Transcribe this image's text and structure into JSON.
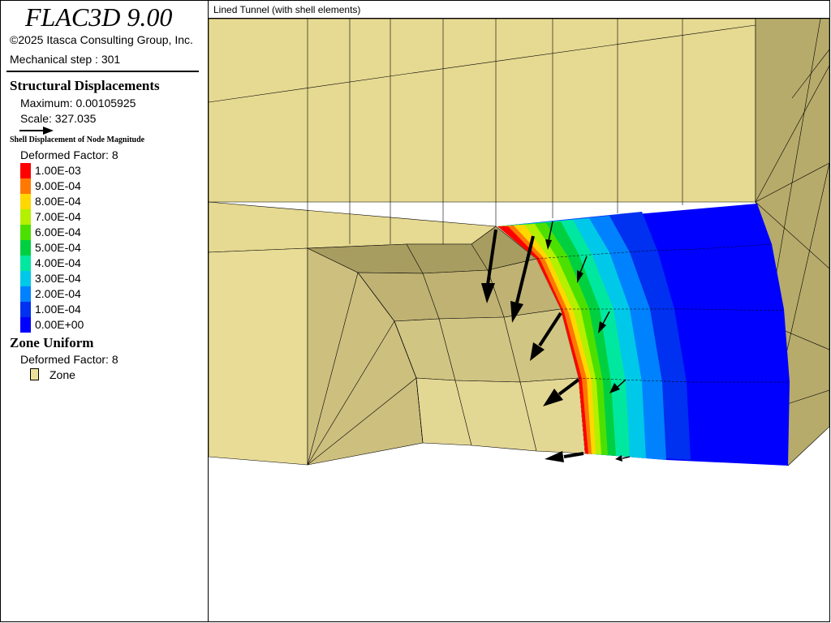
{
  "legend": {
    "app_title": "FLAC3D 9.00",
    "copyright": "©2025 Itasca Consulting Group, Inc.",
    "step": "Mechanical step : 301",
    "struct_title": "Structural Displacements",
    "maximum": "Maximum: 0.00105925",
    "scale": "Scale: 327.035",
    "shell_title": "Shell Displacement of Node Magnitude",
    "deformed_factor_1": "Deformed Factor: 8",
    "contours": [
      {
        "label": "1.00E-03",
        "color": "#FF0000"
      },
      {
        "label": "9.00E-04",
        "color": "#FF7800"
      },
      {
        "label": "8.00E-04",
        "color": "#FFD800"
      },
      {
        "label": "7.00E-04",
        "color": "#B4F000"
      },
      {
        "label": "6.00E-04",
        "color": "#4CE000"
      },
      {
        "label": "5.00E-04",
        "color": "#00D040"
      },
      {
        "label": "4.00E-04",
        "color": "#00E8A0"
      },
      {
        "label": "3.00E-04",
        "color": "#00C8E8"
      },
      {
        "label": "2.00E-04",
        "color": "#0082FF"
      },
      {
        "label": "1.00E-04",
        "color": "#0030F0"
      },
      {
        "label": "0.00E+00",
        "color": "#0000FF"
      }
    ],
    "zone_title": "Zone Uniform",
    "deformed_factor_2": "Deformed Factor: 8",
    "zone_label": "Zone",
    "zone_color": "#ECE19A"
  },
  "view": {
    "title": "Lined Tunnel (with shell elements)"
  }
}
